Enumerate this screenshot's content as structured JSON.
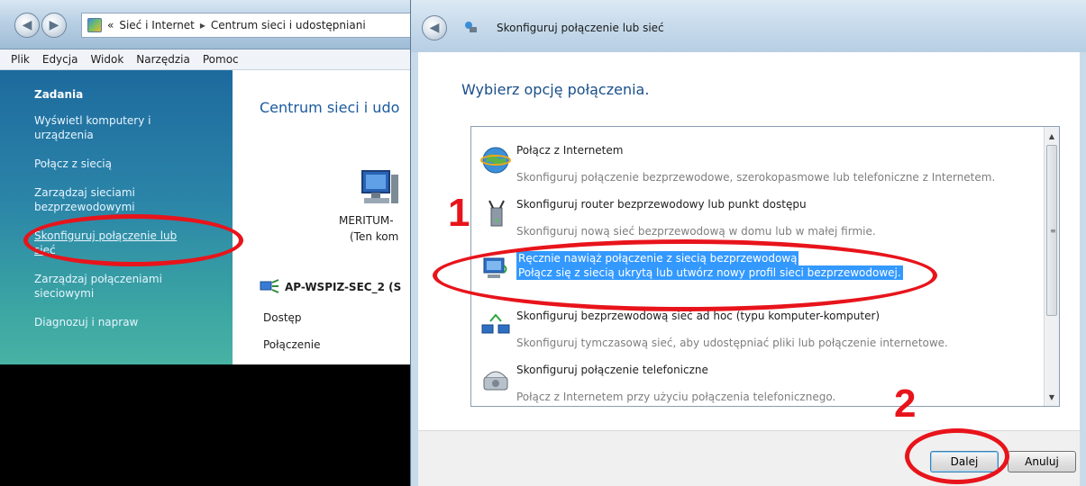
{
  "left_window": {
    "breadcrumb": {
      "overflow": "«",
      "item1": "Sieć i Internet",
      "separator": "▸",
      "item2": "Centrum sieci i udostępniani"
    },
    "menu": [
      "Plik",
      "Edycja",
      "Widok",
      "Narzędzia",
      "Pomoc"
    ],
    "sidebar": {
      "heading": "Zadania",
      "links": [
        "Wyświetl komputery i urządzenia",
        "Połącz z siecią",
        "Zarządzaj sieciami bezprzewodowymi",
        "Skonfiguruj połączenie lub sieć",
        "Zarządzaj połączeniami sieciowymi",
        "Diagnozuj i napraw"
      ]
    },
    "content": {
      "title": "Centrum sieci i udo",
      "computer_name": "MERITUM-",
      "computer_sub": "(Ten kom",
      "network_name": "AP-WSPIZ-SEC_2 (S",
      "access_label": "Dostęp",
      "connection_label": "Połączenie"
    }
  },
  "dialog": {
    "title": "Skonfiguruj połączenie lub sieć",
    "heading": "Wybierz opcję połączenia.",
    "options": [
      {
        "title": "Połącz z Internetem",
        "desc": "Skonfiguruj połączenie bezprzewodowe, szerokopasmowe lub telefoniczne z Internetem.",
        "icon": "globe-icon"
      },
      {
        "title": "Skonfiguruj router bezprzewodowy lub punkt dostępu",
        "desc": "Skonfiguruj nową sieć bezprzewodową w domu lub w małej firmie.",
        "icon": "router-icon"
      },
      {
        "title": "Ręcznie nawiąż połączenie z siecią bezprzewodową",
        "desc": "Połącz się z siecią ukrytą lub utwórz nowy profil sieci bezprzewodowej.",
        "icon": "wireless-computer-icon",
        "selected": true
      },
      {
        "title": "Skonfiguruj bezprzewodową sieć ad hoc (typu komputer-komputer)",
        "desc": "Skonfiguruj tymczasową sieć, aby udostępniać pliki lub połączenie internetowe.",
        "icon": "adhoc-network-icon"
      },
      {
        "title": "Skonfiguruj połączenie telefoniczne",
        "desc": "Połącz z Internetem przy użyciu połączenia telefonicznego.",
        "icon": "phone-icon"
      }
    ],
    "buttons": {
      "next": "Dalej",
      "cancel": "Anuluj"
    }
  },
  "annotations": {
    "step1": "1",
    "step2": "2",
    "color": "#e8141b"
  },
  "colors": {
    "selection": "#3399ff",
    "sidebar_top": "#1d6a9e",
    "sidebar_bottom": "#48b2a4",
    "heading": "#1a4f8a"
  }
}
